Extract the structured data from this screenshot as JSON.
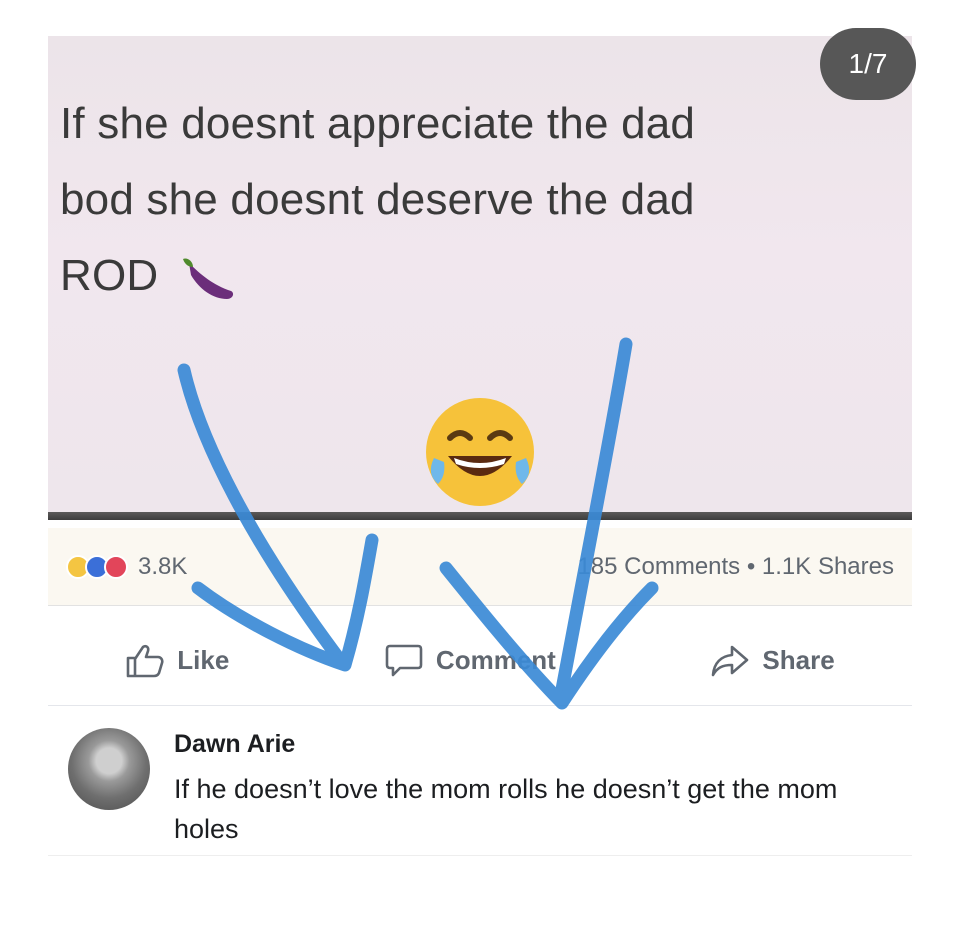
{
  "counter": "1/7",
  "post": {
    "text_lines": [
      "If she doesnt appreciate the dad",
      "bod she doesnt deserve the dad",
      "ROD"
    ],
    "emoji_icons": [
      "eggplant-icon",
      "tears-of-joy-icon"
    ]
  },
  "reactions": {
    "icons": [
      "haha-icon",
      "like-icon",
      "love-icon"
    ],
    "count": "3.8K",
    "stats": "185 Comments • 1.1K Shares"
  },
  "actions": {
    "like": "Like",
    "comment": "Comment",
    "share": "Share"
  },
  "comment": {
    "author": "Dawn Arie",
    "text": "If he doesn’t love the mom rolls he doesn’t get the mom holes"
  },
  "colors": {
    "scribble": "#3b8ad6",
    "counter_bg": "#575757"
  }
}
